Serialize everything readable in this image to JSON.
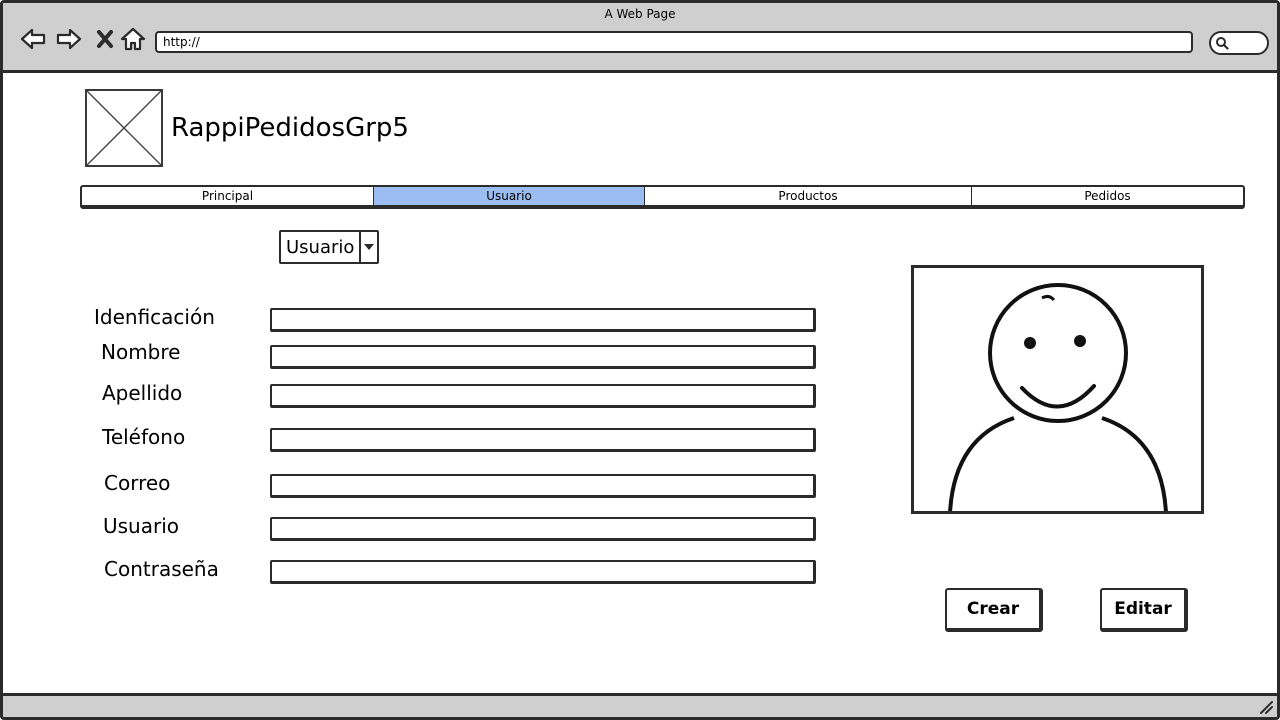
{
  "browser": {
    "window_title": "A Web Page",
    "url": "http://",
    "icons": {
      "back": "back-arrow-icon",
      "forward": "forward-arrow-icon",
      "close": "close-x-icon",
      "home": "home-icon",
      "search": "search-icon"
    }
  },
  "header": {
    "app_name": "RappiPedidosGrp5",
    "logo": "image-placeholder-icon"
  },
  "tabs": [
    {
      "label": "Principal",
      "active": false
    },
    {
      "label": "Usuario",
      "active": true
    },
    {
      "label": "Productos",
      "active": false
    },
    {
      "label": "Pedidos",
      "active": false
    }
  ],
  "selector": {
    "value": "Usuario"
  },
  "form": {
    "fields": [
      {
        "label": "Idenficación",
        "value": ""
      },
      {
        "label": "Nombre",
        "value": ""
      },
      {
        "label": "Apellido",
        "value": ""
      },
      {
        "label": "Teléfono",
        "value": ""
      },
      {
        "label": "Correo",
        "value": ""
      },
      {
        "label": "Usuario",
        "value": ""
      },
      {
        "label": "Contraseña",
        "value": ""
      }
    ]
  },
  "avatar": {
    "icon": "user-avatar-icon"
  },
  "actions": {
    "create_label": "Crear",
    "edit_label": "Editar"
  },
  "colors": {
    "active_tab": "#9bbdf2",
    "chrome": "#cfcfcf",
    "stroke": "#2b2b2b"
  }
}
